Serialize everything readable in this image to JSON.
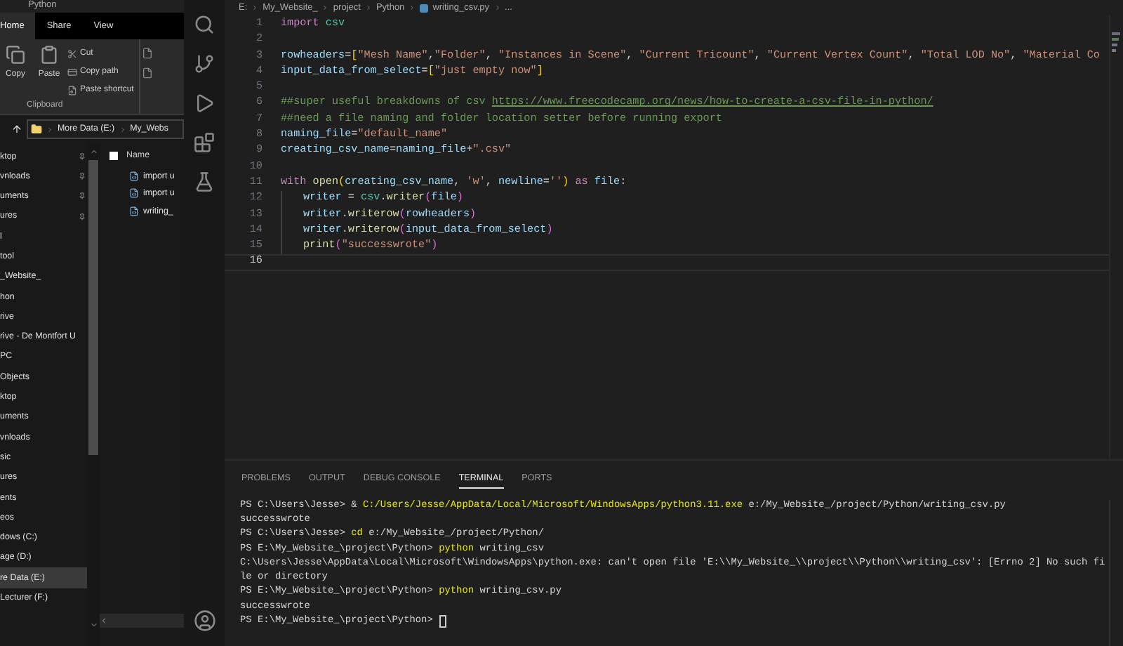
{
  "explorer": {
    "title": "Python",
    "ribbon_tabs": [
      {
        "label": "Home",
        "selected": true
      },
      {
        "label": "Share",
        "selected": false
      },
      {
        "label": "View",
        "selected": false
      }
    ],
    "large_buttons": [
      "Copy",
      "Paste"
    ],
    "small_buttons": [
      "Cut",
      "Copy path",
      "Paste shortcut"
    ],
    "group_label": "Clipboard",
    "address": [
      "More Data (E:)",
      "My_Webs"
    ],
    "nav_items": [
      {
        "label": "ktop",
        "pinned": true,
        "selected": false
      },
      {
        "label": "vnloads",
        "pinned": true,
        "selected": false
      },
      {
        "label": "uments",
        "pinned": true,
        "selected": false
      },
      {
        "label": "ures",
        "pinned": true,
        "selected": false
      },
      {
        "label": "l",
        "pinned": false,
        "selected": false
      },
      {
        "label": "tool",
        "pinned": false,
        "selected": false
      },
      {
        "label": "_Website_",
        "pinned": false,
        "selected": false
      },
      {
        "label": "hon",
        "pinned": false,
        "selected": false
      },
      {
        "label": "rive",
        "pinned": false,
        "selected": false
      },
      {
        "label": "rive - De Montfort U",
        "pinned": false,
        "selected": false
      },
      {
        "label": "PC",
        "pinned": false,
        "selected": false
      },
      {
        "label": "Objects",
        "pinned": false,
        "selected": false
      },
      {
        "label": "ktop",
        "pinned": false,
        "selected": false
      },
      {
        "label": "uments",
        "pinned": false,
        "selected": false
      },
      {
        "label": "vnloads",
        "pinned": false,
        "selected": false
      },
      {
        "label": "sic",
        "pinned": false,
        "selected": false
      },
      {
        "label": "ures",
        "pinned": false,
        "selected": false
      },
      {
        "label": "ents",
        "pinned": false,
        "selected": false
      },
      {
        "label": "eos",
        "pinned": false,
        "selected": false
      },
      {
        "label": "dows (C:)",
        "pinned": false,
        "selected": false
      },
      {
        "label": "age (D:)",
        "pinned": false,
        "selected": false
      },
      {
        "label": "re Data (E:)",
        "pinned": false,
        "selected": true
      },
      {
        "label": "Lecturer (F:)",
        "pinned": false,
        "selected": false
      }
    ],
    "select_all_checked": false,
    "files_header": "Name",
    "files": [
      "import u",
      "import u",
      "writing_"
    ]
  },
  "editor": {
    "breadcrumb": [
      "E:",
      "My_Website_",
      "project",
      "Python",
      "writing_csv.py",
      "..."
    ],
    "lines": [
      {
        "number": "1",
        "current": false,
        "indented": false,
        "tokens": [
          {
            "kind": "kw",
            "text": "import "
          },
          {
            "kind": "mod",
            "text": "csv"
          }
        ]
      },
      {
        "number": "2",
        "current": false,
        "indented": false
      },
      {
        "number": "3",
        "current": false,
        "indented": false,
        "tokens": [
          {
            "kind": "var",
            "text": "rowheaders"
          },
          {
            "kind": "plain",
            "text": "="
          },
          {
            "kind": "br",
            "text": "["
          },
          {
            "kind": "str",
            "text": "\"Mesh Name\""
          },
          {
            "kind": "plain",
            "text": ","
          },
          {
            "kind": "str",
            "text": "\"Folder\""
          },
          {
            "kind": "plain",
            "text": ", "
          },
          {
            "kind": "str",
            "text": "\"Instances in Scene\""
          },
          {
            "kind": "plain",
            "text": ", "
          },
          {
            "kind": "str",
            "text": "\"Current Tricount\""
          },
          {
            "kind": "plain",
            "text": ", "
          },
          {
            "kind": "str",
            "text": "\"Current Vertex Count\""
          },
          {
            "kind": "plain",
            "text": ", "
          },
          {
            "kind": "str",
            "text": "\"Total LOD No\""
          },
          {
            "kind": "plain",
            "text": ", "
          },
          {
            "kind": "str",
            "text": "\"Material Co"
          }
        ]
      },
      {
        "number": "4",
        "current": false,
        "indented": false,
        "tokens": [
          {
            "kind": "var",
            "text": "input_data_from_select"
          },
          {
            "kind": "plain",
            "text": "="
          },
          {
            "kind": "br",
            "text": "["
          },
          {
            "kind": "str",
            "text": "\"just empty now\""
          },
          {
            "kind": "br",
            "text": "]"
          }
        ]
      },
      {
        "number": "5",
        "current": false,
        "indented": false
      },
      {
        "number": "6",
        "current": false,
        "indented": false,
        "tokens": [
          {
            "kind": "com",
            "text": "##super useful breakdowns of csv "
          },
          {
            "kind": "link",
            "text": "https://www.freecodecamp.org/news/how-to-create-a-csv-file-in-python/"
          }
        ]
      },
      {
        "number": "7",
        "current": false,
        "indented": false,
        "tokens": [
          {
            "kind": "com",
            "text": "##need a file naming and folder location setter before running export"
          }
        ]
      },
      {
        "number": "8",
        "current": false,
        "indented": false,
        "tokens": [
          {
            "kind": "var",
            "text": "naming_file"
          },
          {
            "kind": "plain",
            "text": "="
          },
          {
            "kind": "str",
            "text": "\"default_name\""
          }
        ]
      },
      {
        "number": "9",
        "current": false,
        "indented": false,
        "tokens": [
          {
            "kind": "var",
            "text": "creating_csv_name"
          },
          {
            "kind": "plain",
            "text": "="
          },
          {
            "kind": "var",
            "text": "naming_file"
          },
          {
            "kind": "plain",
            "text": "+"
          },
          {
            "kind": "str",
            "text": "\".csv\""
          }
        ]
      },
      {
        "number": "10",
        "current": false,
        "indented": false
      },
      {
        "number": "11",
        "current": false,
        "indented": false,
        "tokens": [
          {
            "kind": "kw",
            "text": "with "
          },
          {
            "kind": "fn",
            "text": "open"
          },
          {
            "kind": "br",
            "text": "("
          },
          {
            "kind": "var",
            "text": "creating_csv_name"
          },
          {
            "kind": "plain",
            "text": ", "
          },
          {
            "kind": "str",
            "text": "'w'"
          },
          {
            "kind": "plain",
            "text": ", "
          },
          {
            "kind": "var",
            "text": "newline"
          },
          {
            "kind": "plain",
            "text": "="
          },
          {
            "kind": "str",
            "text": "''"
          },
          {
            "kind": "br",
            "text": ")"
          },
          {
            "kind": "kw",
            "text": " as "
          },
          {
            "kind": "var",
            "text": "file"
          },
          {
            "kind": "plain",
            "text": ":"
          }
        ]
      },
      {
        "number": "12",
        "current": false,
        "indented": true,
        "tokens": [
          {
            "kind": "var",
            "text": "writer"
          },
          {
            "kind": "plain",
            "text": " = "
          },
          {
            "kind": "mod",
            "text": "csv"
          },
          {
            "kind": "plain",
            "text": "."
          },
          {
            "kind": "fn",
            "text": "writer"
          },
          {
            "kind": "br2",
            "text": "("
          },
          {
            "kind": "var",
            "text": "file"
          },
          {
            "kind": "br2",
            "text": ")"
          }
        ]
      },
      {
        "number": "13",
        "current": false,
        "indented": true,
        "tokens": [
          {
            "kind": "var",
            "text": "writer"
          },
          {
            "kind": "plain",
            "text": "."
          },
          {
            "kind": "fn",
            "text": "writerow"
          },
          {
            "kind": "br2",
            "text": "("
          },
          {
            "kind": "var",
            "text": "rowheaders"
          },
          {
            "kind": "br2",
            "text": ")"
          }
        ]
      },
      {
        "number": "14",
        "current": false,
        "indented": true,
        "tokens": [
          {
            "kind": "var",
            "text": "writer"
          },
          {
            "kind": "plain",
            "text": "."
          },
          {
            "kind": "fn",
            "text": "writerow"
          },
          {
            "kind": "br2",
            "text": "("
          },
          {
            "kind": "var",
            "text": "input_data_from_select"
          },
          {
            "kind": "br2",
            "text": ")"
          }
        ]
      },
      {
        "number": "15",
        "current": false,
        "indented": true,
        "tokens": [
          {
            "kind": "fn",
            "text": "print"
          },
          {
            "kind": "br2",
            "text": "("
          },
          {
            "kind": "str",
            "text": "\"successwrote\""
          },
          {
            "kind": "br2",
            "text": ")"
          }
        ]
      },
      {
        "number": "16",
        "current": true,
        "indented": false
      }
    ]
  },
  "panel": {
    "tabs": [
      {
        "label": "PROBLEMS",
        "selected": false
      },
      {
        "label": "OUTPUT",
        "selected": false
      },
      {
        "label": "DEBUG CONSOLE",
        "selected": false
      },
      {
        "label": "TERMINAL",
        "selected": true
      },
      {
        "label": "PORTS",
        "selected": false
      }
    ],
    "terminal": [
      {
        "cursor": false,
        "tokens": [
          {
            "kind": "plain",
            "text": "PS C:\\Users\\Jesse> & "
          },
          {
            "kind": "cmd",
            "text": "C:/Users/Jesse/AppData/Local/Microsoft/WindowsApps/python3.11.exe"
          },
          {
            "kind": "plain",
            "text": " e:/My_Website_/project/Python/writing_csv.py"
          }
        ]
      },
      {
        "cursor": false,
        "tokens": [
          {
            "kind": "plain",
            "text": "successwrote"
          }
        ]
      },
      {
        "cursor": false,
        "tokens": [
          {
            "kind": "plain",
            "text": "PS C:\\Users\\Jesse> "
          },
          {
            "kind": "cmd",
            "text": "cd"
          },
          {
            "kind": "plain",
            "text": " e:/My_Website_/project/Python/"
          }
        ]
      },
      {
        "cursor": false,
        "tokens": [
          {
            "kind": "plain",
            "text": "PS E:\\My_Website_\\project\\Python> "
          },
          {
            "kind": "cmd",
            "text": "python"
          },
          {
            "kind": "plain",
            "text": " writing_csv"
          }
        ]
      },
      {
        "cursor": false,
        "tokens": [
          {
            "kind": "plain",
            "text": "C:\\Users\\Jesse\\AppData\\Local\\Microsoft\\WindowsApps\\python.exe: can't open file 'E:\\\\My_Website_\\\\project\\\\Python\\\\writing_csv': [Errno 2] No such fi"
          }
        ]
      },
      {
        "cursor": false,
        "tokens": [
          {
            "kind": "plain",
            "text": "le or directory"
          }
        ]
      },
      {
        "cursor": false,
        "tokens": [
          {
            "kind": "plain",
            "text": "PS E:\\My_Website_\\project\\Python> "
          },
          {
            "kind": "cmd",
            "text": "python"
          },
          {
            "kind": "plain",
            "text": " writing_csv.py"
          }
        ]
      },
      {
        "cursor": false,
        "tokens": [
          {
            "kind": "plain",
            "text": "successwrote"
          }
        ]
      },
      {
        "cursor": true,
        "tokens": [
          {
            "kind": "plain",
            "text": "PS E:\\My_Website_\\project\\Python> "
          }
        ]
      }
    ]
  }
}
